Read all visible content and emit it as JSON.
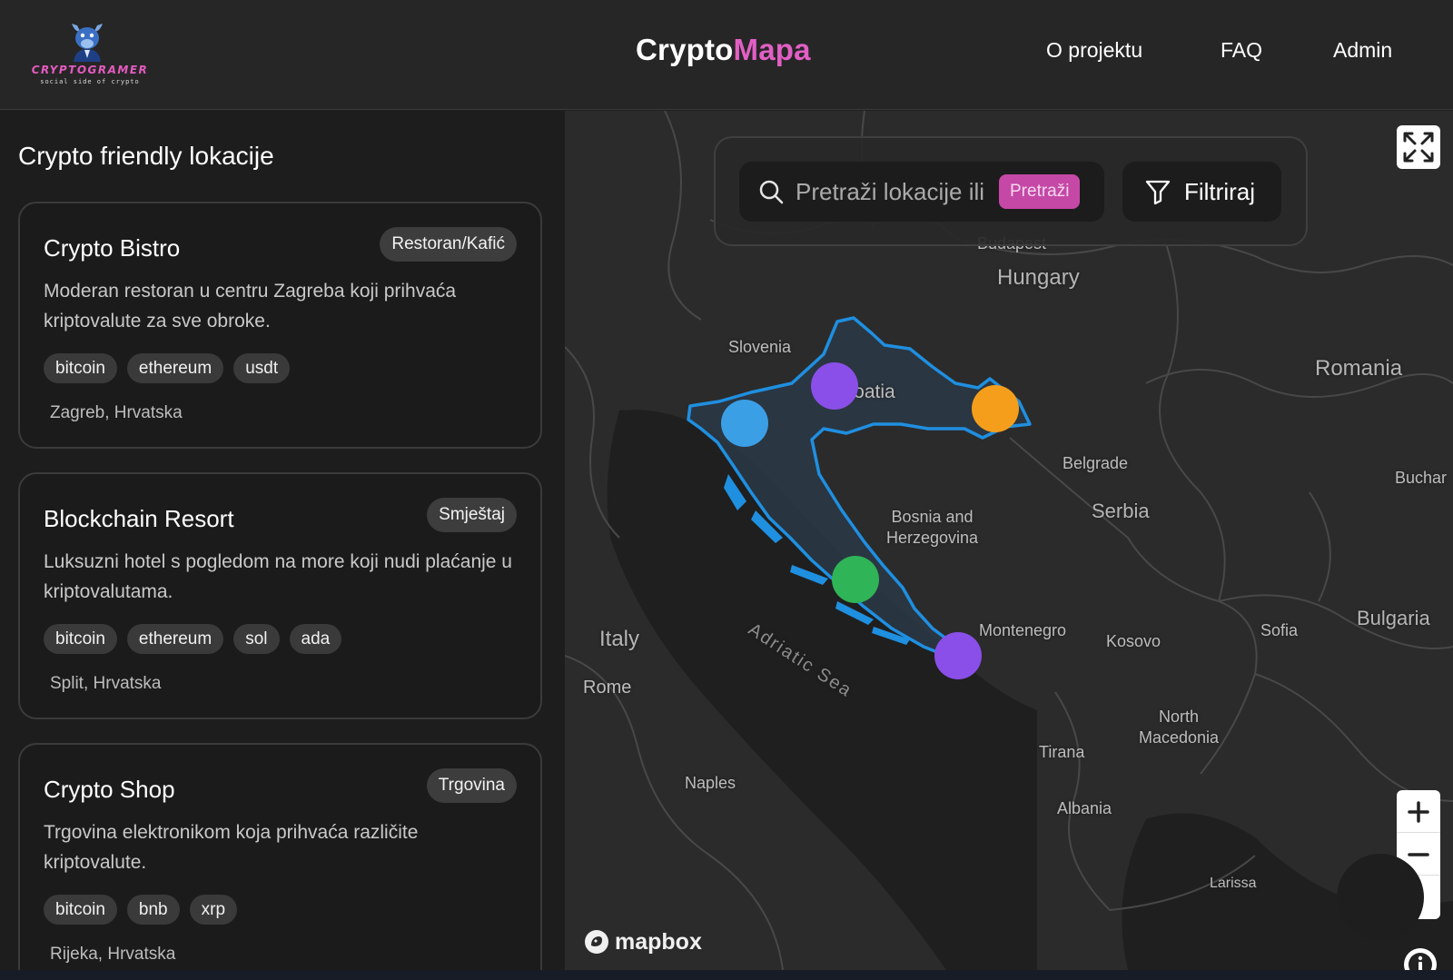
{
  "header": {
    "logo": {
      "name": "CRYPTOGRAMER",
      "tagline": "social side of crypto"
    },
    "brand": {
      "part1": "Crypto",
      "part2": "Mapa"
    },
    "nav": {
      "about": "O projektu",
      "faq": "FAQ",
      "admin": "Admin"
    }
  },
  "sidebar": {
    "title": "Crypto friendly lokacije",
    "locations": [
      {
        "name": "Crypto Bistro",
        "category": "Restoran/Kafić",
        "description": "Moderan restoran u centru Zagreba koji prihvaća kriptovalute za sve obroke.",
        "tags": [
          "bitcoin",
          "ethereum",
          "usdt"
        ],
        "location": "Zagreb, Hrvatska"
      },
      {
        "name": "Blockchain Resort",
        "category": "Smještaj",
        "description": "Luksuzni hotel s pogledom na more koji nudi plaćanje u kriptovalutama.",
        "tags": [
          "bitcoin",
          "ethereum",
          "sol",
          "ada"
        ],
        "location": "Split, Hrvatska"
      },
      {
        "name": "Crypto Shop",
        "category": "Trgovina",
        "description": "Trgovina elektronikom koja prihvaća različite kriptovalute.",
        "tags": [
          "bitcoin",
          "bnb",
          "xrp"
        ],
        "location": "Rijeka, Hrvatska"
      }
    ]
  },
  "map": {
    "search": {
      "placeholder": "Pretraži lokacije ili",
      "button": "Pretraži"
    },
    "filter_label": "Filtriraj",
    "labels": {
      "budapest": "Budapest",
      "hungary": "Hungary",
      "slovenia": "Slovenia",
      "croatia": "Croatia",
      "romania": "Romania",
      "belgrade": "Belgrade",
      "bucharest": "Buchar",
      "bosnia1": "Bosnia and",
      "bosnia2": "Herzegovina",
      "serbia": "Serbia",
      "adriatic": "Adriatic Sea",
      "italy": "Italy",
      "rome": "Rome",
      "montenegro": "Montenegro",
      "kosovo": "Kosovo",
      "sofia": "Sofia",
      "bulgaria": "Bulgaria",
      "north_macedonia1": "North",
      "north_macedonia2": "Macedonia",
      "tirana": "Tirana",
      "naples": "Naples",
      "albania": "Albania",
      "larissa": "Larissa"
    },
    "attribution": "mapbox",
    "marker_colors": {
      "blue": "#3b9fe6",
      "purple": "#8a4fe8",
      "orange": "#f59e1b",
      "green": "#2fb457"
    },
    "accent": "#e25fc5"
  }
}
